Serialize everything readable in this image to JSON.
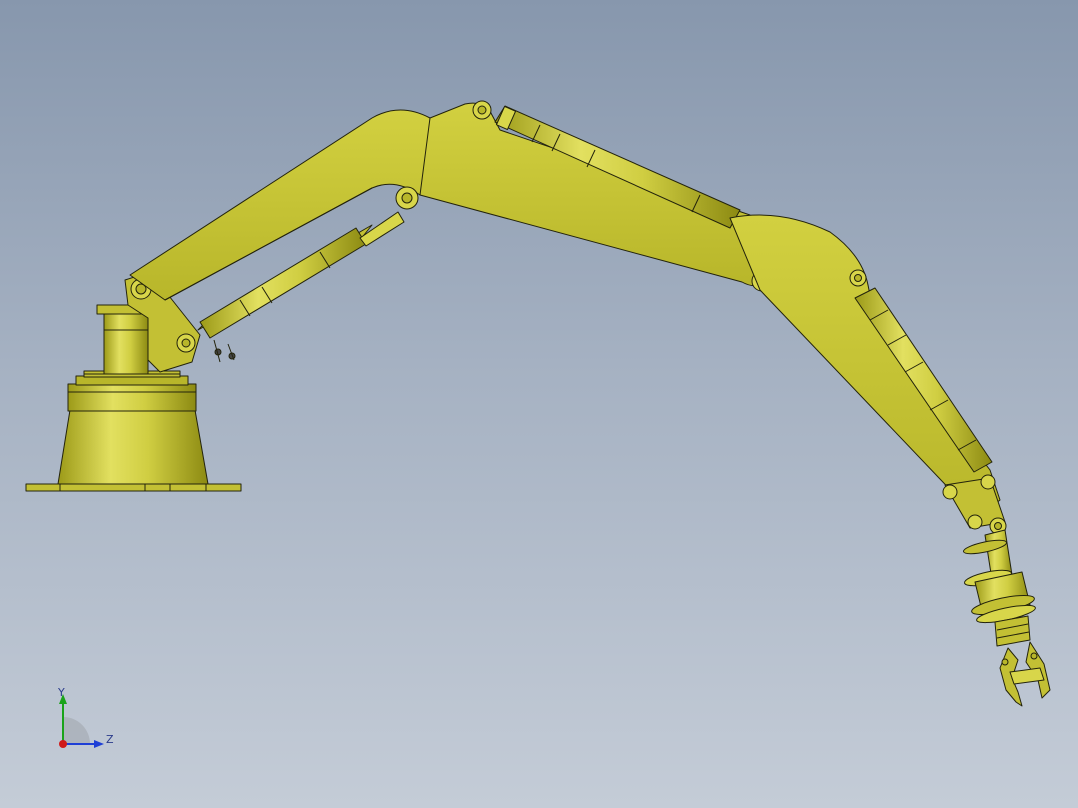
{
  "viewport": {
    "background_top": "#8797ad",
    "background_bottom": "#c4ccd7"
  },
  "model": {
    "subject": "hydraulic-robot-arm",
    "body_color": "#c3c034",
    "shade_color": "#a6a51f",
    "highlight_color": "#e6e66a",
    "outline_color": "#23230c"
  },
  "triad": {
    "y_label": "Y",
    "z_label": "Z",
    "y_color": "#1aa31a",
    "z_color": "#1f3fd6",
    "x_color": "#d01a1a"
  }
}
